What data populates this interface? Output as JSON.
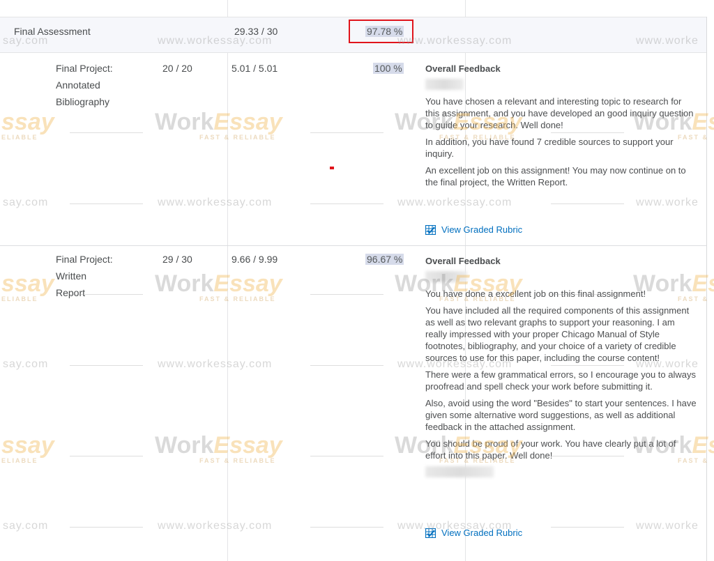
{
  "summary": {
    "name": "Final Assessment",
    "points": "29.33 / 30",
    "grade": "97.78 %"
  },
  "items": [
    {
      "name_lines": [
        "Final Project:",
        "Annotated",
        "Bibliography"
      ],
      "points": "20 / 20",
      "weighted": "5.01 / 5.01",
      "grade": "100 %",
      "feedback_title": "Overall Feedback",
      "paragraphs": [
        "You have chosen a relevant and interesting topic to research for this assignment, and you have developed an good inquiry question to guide your research. Well done!",
        "In addition, you have found 7 credible sources to support your inquiry.",
        "An excellent job on this assignment! You may now continue on to the final project, the Written Report."
      ],
      "rubric_label": "View Graded Rubric"
    },
    {
      "name_lines": [
        "Final Project:",
        "Written",
        "Report"
      ],
      "points": "29 / 30",
      "weighted": "9.66 / 9.99",
      "grade": "96.67 %",
      "feedback_title": "Overall Feedback",
      "paragraphs": [
        "You have done a excellent job on this final assignment!",
        "You have included all the required components of this assignment as well as two relevant graphs to support your reasoning.  I am really impressed with your proper Chicago Manual of Style footnotes, bibliography, and your choice of a variety of credible sources to use for this paper, including the course content!",
        "There were a few grammatical errors, so I encourage you to always proofread and spell check your work before submitting it.",
        "Also, avoid using the word \"Besides\" to start your sentences. I have given some alternative word suggestions, as well as additional feedback in the attached assignment.",
        "You should be proud of your work. You have clearly put a lot of effort into this paper. Well done!"
      ],
      "rubric_label": "View Graded Rubric"
    }
  ],
  "watermark": {
    "url_text": "www.workessay.com",
    "url_partial_left": "say.com",
    "url_partial_right": "www.worke",
    "logo_a": "Work",
    "logo_b": "Essay",
    "logo_partial": "ssay",
    "tagline": "FAST & RELIABLE",
    "tagline_partial": "ELIABLE",
    "tagline_partial_right": "FAST &"
  },
  "colors": {
    "link": "#006fbf",
    "highlight_border": "#e0141b",
    "grade_bg": "#d6dbea"
  }
}
